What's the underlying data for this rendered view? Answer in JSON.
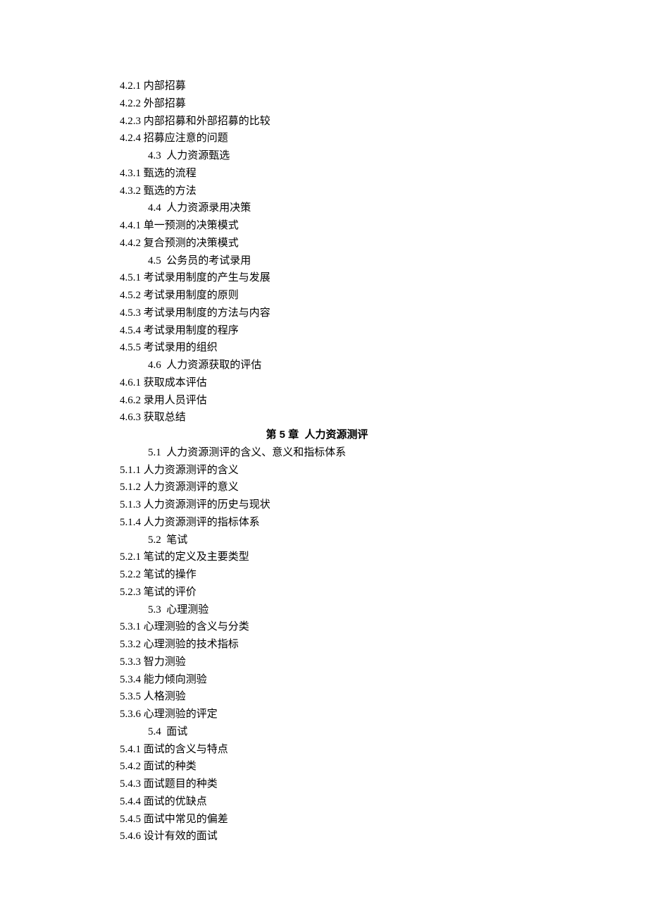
{
  "lines": [
    {
      "kind": "item",
      "text": "4.2.1 内部招募"
    },
    {
      "kind": "item",
      "text": "4.2.2 外部招募"
    },
    {
      "kind": "item",
      "text": "4.2.3 内部招募和外部招募的比较"
    },
    {
      "kind": "item",
      "text": "4.2.4 招募应注意的问题"
    },
    {
      "kind": "section",
      "text": "4.3  人力资源甄选"
    },
    {
      "kind": "item",
      "text": "4.3.1 甄选的流程"
    },
    {
      "kind": "item",
      "text": "4.3.2 甄选的方法"
    },
    {
      "kind": "section",
      "text": "4.4  人力资源录用决策"
    },
    {
      "kind": "item",
      "text": "4.4.1 单一预测的决策模式"
    },
    {
      "kind": "item",
      "text": "4.4.2 复合预测的决策模式"
    },
    {
      "kind": "section",
      "text": "4.5  公务员的考试录用"
    },
    {
      "kind": "item",
      "text": "4.5.1 考试录用制度的产生与发展"
    },
    {
      "kind": "item",
      "text": "4.5.2 考试录用制度的原则"
    },
    {
      "kind": "item",
      "text": "4.5.3 考试录用制度的方法与内容"
    },
    {
      "kind": "item",
      "text": "4.5.4 考试录用制度的程序"
    },
    {
      "kind": "item",
      "text": "4.5.5 考试录用的组织"
    },
    {
      "kind": "section",
      "text": "4.6  人力资源获取的评估"
    },
    {
      "kind": "item",
      "text": "4.6.1 获取成本评估"
    },
    {
      "kind": "item",
      "text": "4.6.2 录用人员评估"
    },
    {
      "kind": "item",
      "text": "4.6.3 获取总结"
    },
    {
      "kind": "chapter",
      "text": "第 5 章  人力资源测评"
    },
    {
      "kind": "section",
      "text": "5.1  人力资源测评的含义、意义和指标体系"
    },
    {
      "kind": "item",
      "text": "5.1.1 人力资源测评的含义"
    },
    {
      "kind": "item",
      "text": "5.1.2 人力资源测评的意义"
    },
    {
      "kind": "item",
      "text": "5.1.3 人力资源测评的历史与现状"
    },
    {
      "kind": "item",
      "text": "5.1.4 人力资源测评的指标体系"
    },
    {
      "kind": "section",
      "text": "5.2  笔试"
    },
    {
      "kind": "item",
      "text": "5.2.1 笔试的定义及主要类型"
    },
    {
      "kind": "item",
      "text": "5.2.2 笔试的操作"
    },
    {
      "kind": "item",
      "text": "5.2.3 笔试的评价"
    },
    {
      "kind": "section",
      "text": "5.3  心理测验"
    },
    {
      "kind": "item",
      "text": "5.3.1 心理测验的含义与分类"
    },
    {
      "kind": "item",
      "text": "5.3.2 心理测验的技术指标"
    },
    {
      "kind": "item",
      "text": "5.3.3 智力测验"
    },
    {
      "kind": "item",
      "text": "5.3.4 能力倾向测验"
    },
    {
      "kind": "item",
      "text": "5.3.5 人格测验"
    },
    {
      "kind": "item",
      "text": "5.3.6 心理测验的评定"
    },
    {
      "kind": "section",
      "text": "5.4  面试"
    },
    {
      "kind": "item",
      "text": "5.4.1 面试的含义与特点"
    },
    {
      "kind": "item",
      "text": "5.4.2 面试的种类"
    },
    {
      "kind": "item",
      "text": "5.4.3 面试题目的种类"
    },
    {
      "kind": "item",
      "text": "5.4.4 面试的优缺点"
    },
    {
      "kind": "item",
      "text": "5.4.5 面试中常见的偏差"
    },
    {
      "kind": "item",
      "text": "5.4.6 设计有效的面试"
    }
  ]
}
